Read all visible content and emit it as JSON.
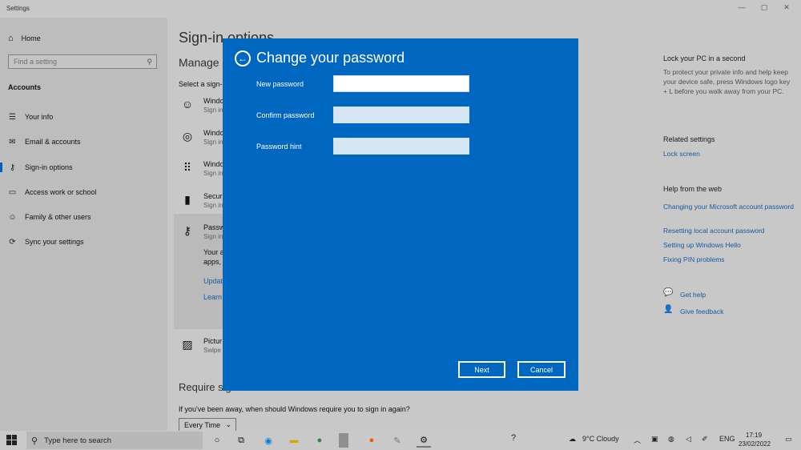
{
  "window": {
    "title": "Settings"
  },
  "nav": {
    "home": "Home",
    "search_placeholder": "Find a setting",
    "section": "Accounts",
    "items": [
      {
        "label": "Your info",
        "icon": "person-card-icon"
      },
      {
        "label": "Email & accounts",
        "icon": "mail-icon"
      },
      {
        "label": "Sign-in options",
        "icon": "key-icon"
      },
      {
        "label": "Access work or school",
        "icon": "briefcase-icon"
      },
      {
        "label": "Family & other users",
        "icon": "people-icon"
      },
      {
        "label": "Sync your settings",
        "icon": "sync-icon"
      }
    ]
  },
  "main": {
    "title": "Sign-in options",
    "manage": "Manage h",
    "select": "Select a sign-",
    "options": [
      {
        "title": "Windo",
        "sub": "Sign in",
        "icon": "face-icon"
      },
      {
        "title": "Windo",
        "sub": "Sign in",
        "icon": "fingerprint-icon"
      },
      {
        "title": "Windo",
        "sub": "Sign in",
        "icon": "pin-keypad-icon"
      },
      {
        "title": "Securi",
        "sub": "Sign in",
        "icon": "security-key-icon"
      },
      {
        "title": "Passw",
        "sub": "Sign in",
        "icon": "key-icon"
      }
    ],
    "password_desc_1": "Your a",
    "password_desc_2": "apps,",
    "update_link": "Updat",
    "learn_link": "Learn",
    "picture": {
      "title": "Pictur",
      "sub": "Swipe",
      "icon": "picture-icon"
    },
    "require_title": "Require sign-in",
    "require_question": "If you've been away, when should Windows require you to sign in again?",
    "require_value": "Every Time"
  },
  "right": {
    "lock_title": "Lock your PC in a second",
    "lock_text": "To protect your private info and help keep your device safe, press Windows logo key + L before you walk away from your PC.",
    "related_title": "Related settings",
    "related_links": [
      "Lock screen"
    ],
    "help_title": "Help from the web",
    "help_links": [
      "Changing your Microsoft account password",
      "Resetting local account password",
      "Setting up Windows Hello",
      "Fixing PIN problems"
    ],
    "get_help": "Get help",
    "give_feedback": "Give feedback"
  },
  "dialog": {
    "title": "Change your password",
    "fields": [
      {
        "label": "New password",
        "value": ""
      },
      {
        "label": "Confirm password",
        "value": ""
      },
      {
        "label": "Password hint",
        "value": ""
      }
    ],
    "next": "Next",
    "cancel": "Cancel"
  },
  "taskbar": {
    "search_placeholder": "Type here to search",
    "weather": "9°C  Cloudy",
    "lang": "ENG",
    "time": "17:19",
    "date": "23/02/2022"
  },
  "colors": {
    "accent": "#0067c0",
    "link": "#1a5fa8"
  }
}
